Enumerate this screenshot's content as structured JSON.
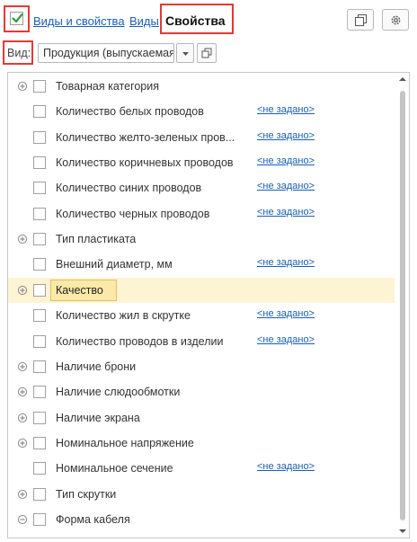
{
  "header": {
    "links": {
      "views_and_properties": "Виды и свойства",
      "views": "Виды"
    },
    "title": "Свойства",
    "checkbox_checked": true
  },
  "view_selector": {
    "label": "Вид:",
    "value": "Продукция (выпускаемая"
  },
  "properties": {
    "rows": [
      {
        "name": "Товарная категория",
        "value": "",
        "expander": "plus",
        "highlighted": false
      },
      {
        "name": "Количество белых проводов",
        "value": "<не задано>",
        "expander": "none",
        "highlighted": false
      },
      {
        "name": "Количество желто-зеленых пров...",
        "value": "<не задано>",
        "expander": "none",
        "highlighted": false
      },
      {
        "name": "Количество коричневых проводов",
        "value": "<не задано>",
        "expander": "none",
        "highlighted": false
      },
      {
        "name": "Количество синих проводов",
        "value": "<не задано>",
        "expander": "none",
        "highlighted": false
      },
      {
        "name": "Количество черных проводов",
        "value": "<не задано>",
        "expander": "none",
        "highlighted": false
      },
      {
        "name": "Тип пластиката",
        "value": "",
        "expander": "plus",
        "highlighted": false
      },
      {
        "name": "Внешний диаметр, мм",
        "value": "<не задано>",
        "expander": "none",
        "highlighted": false
      },
      {
        "name": "Качество",
        "value": "",
        "expander": "plus",
        "highlighted": true
      },
      {
        "name": "Количество жил в скрутке",
        "value": "<не задано>",
        "expander": "none",
        "highlighted": false
      },
      {
        "name": "Количество проводов в изделии",
        "value": "<не задано>",
        "expander": "none",
        "highlighted": false
      },
      {
        "name": "Наличие брони",
        "value": "",
        "expander": "plus",
        "highlighted": false
      },
      {
        "name": "Наличие слюдообмотки",
        "value": "",
        "expander": "plus",
        "highlighted": false
      },
      {
        "name": "Наличие экрана",
        "value": "",
        "expander": "plus",
        "highlighted": false
      },
      {
        "name": "Номинальное напряжение",
        "value": "",
        "expander": "plus",
        "highlighted": false
      },
      {
        "name": "Номинальное сечение",
        "value": "<не задано>",
        "expander": "none",
        "highlighted": false
      },
      {
        "name": "Тип скрутки",
        "value": "",
        "expander": "plus",
        "highlighted": false
      },
      {
        "name": "Форма кабеля",
        "value": "",
        "expander": "minus",
        "highlighted": false
      }
    ]
  },
  "icons": {
    "checkbox": "checkmark-icon",
    "copy_button": "copy-windows-icon",
    "settings_button": "gear-icon",
    "dropdown": "caret-down-icon",
    "open_view": "open-window-icon",
    "expand": "expand-plus-icon",
    "collapse": "collapse-minus-icon"
  },
  "colors": {
    "link": "#1a5fb4",
    "highlight_row": "#fdf4d4",
    "highlight_cell": "#fbe9a8",
    "annotation_box": "#e53935",
    "checkmark": "#2e9e3a"
  }
}
